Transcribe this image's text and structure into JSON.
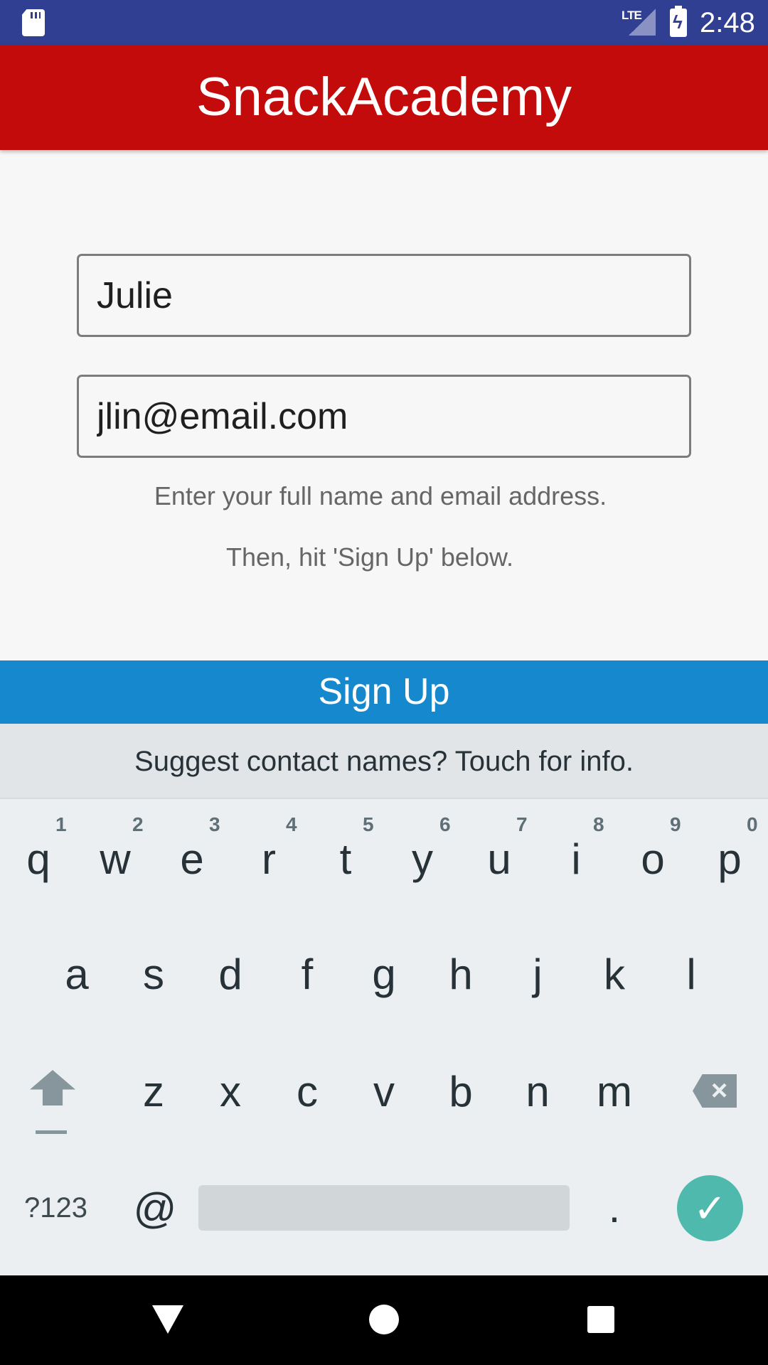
{
  "status_bar": {
    "network": "LTE",
    "time": "2:48"
  },
  "app_bar": {
    "title": "SnackAcademy"
  },
  "form": {
    "name_value": "Julie",
    "email_value": "jlin@email.com",
    "help_line_1": "Enter your full name and email address.",
    "help_line_2": "Then, hit 'Sign Up' below.",
    "signup_label": "Sign Up"
  },
  "keyboard": {
    "suggestion": "Suggest contact names? Touch for info.",
    "row1": [
      "q",
      "w",
      "e",
      "r",
      "t",
      "y",
      "u",
      "i",
      "o",
      "p"
    ],
    "row1_hints": [
      "1",
      "2",
      "3",
      "4",
      "5",
      "6",
      "7",
      "8",
      "9",
      "0"
    ],
    "row2": [
      "a",
      "s",
      "d",
      "f",
      "g",
      "h",
      "j",
      "k",
      "l"
    ],
    "row3": [
      "z",
      "x",
      "c",
      "v",
      "b",
      "n",
      "m"
    ],
    "symbols_label": "?123",
    "at_label": "@",
    "period_label": ".",
    "icons": {
      "shift": "shift-icon",
      "backspace": "backspace-icon",
      "enter": "check-icon"
    }
  },
  "colors": {
    "status_bar": "#303f92",
    "app_bar": "#c30b0b",
    "signup": "#1688cd",
    "enter": "#4fb9ad"
  }
}
